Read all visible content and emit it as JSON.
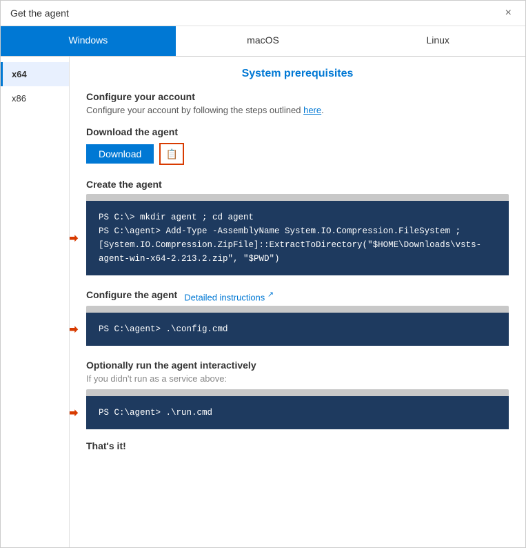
{
  "dialog": {
    "title": "Get the agent",
    "close_label": "×"
  },
  "tabs": [
    {
      "id": "windows",
      "label": "Windows",
      "active": true
    },
    {
      "id": "macos",
      "label": "macOS",
      "active": false
    },
    {
      "id": "linux",
      "label": "Linux",
      "active": false
    }
  ],
  "sidebar": {
    "items": [
      {
        "id": "x64",
        "label": "x64",
        "active": true
      },
      {
        "id": "x86",
        "label": "x86",
        "active": false
      }
    ]
  },
  "main": {
    "section_title": "System prerequisites",
    "configure_account": {
      "title": "Configure your account",
      "description": "Configure your account by following the steps outlined",
      "link_text": "here",
      "link_suffix": "."
    },
    "download_agent": {
      "title": "Download the agent",
      "button_label": "Download"
    },
    "create_agent": {
      "title": "Create the agent",
      "code": "PS C:\\> mkdir agent ; cd agent\nPS C:\\agent> Add-Type -AssemblyName System.IO.Compression.FileSystem ;\n[System.IO.Compression.ZipFile]::ExtractToDirectory(\"$HOME\\Downloads\\vsts-\nagent-win-x64-2.213.2.zip\", \"$PWD\")"
    },
    "configure_agent": {
      "title": "Configure the agent",
      "detailed_link": "Detailed instructions",
      "detailed_icon": "↗",
      "code": "PS C:\\agent> .\\config.cmd"
    },
    "run_agent": {
      "title": "Optionally run the agent interactively",
      "description": "If you didn't run as a service above:",
      "code": "PS C:\\agent> .\\run.cmd"
    },
    "footer": {
      "label": "That's it!"
    }
  }
}
